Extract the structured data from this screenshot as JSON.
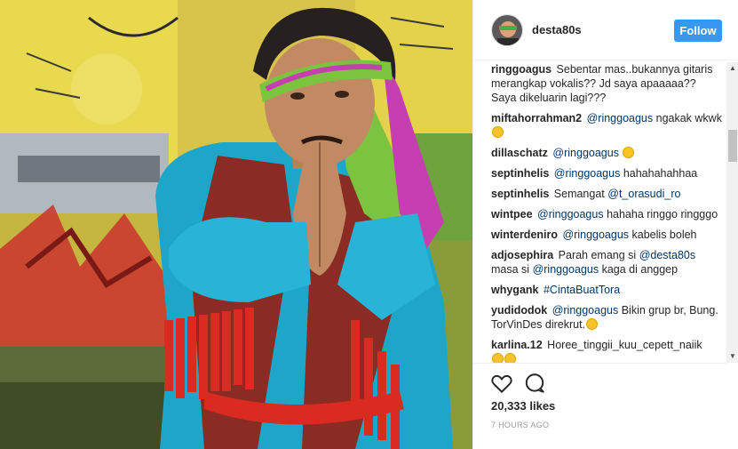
{
  "post": {
    "username": "desta80s",
    "follow_label": "Follow",
    "likes": "20,333 likes",
    "time": "7 HOURS AGO"
  },
  "comments": [
    {
      "user": "ringgoagus",
      "mention": "",
      "text": "Sebentar mas..bukannya gitaris merangkap vokalis?? Jd saya apaaaaa?? Saya dikeluarin lagi???",
      "emoji": ""
    },
    {
      "user": "miftahorrahman2",
      "mention": "@ringgoagus",
      "text": "ngakak wkwk",
      "emoji": "grinning-emoji"
    },
    {
      "user": "dillaschatz",
      "mention": "@ringgoagus",
      "text": "",
      "emoji": "laughing-emoji"
    },
    {
      "user": "septinhelis",
      "mention": "@ringgoagus",
      "text": "hahahahahhaa",
      "emoji": ""
    },
    {
      "user": "septinhelis",
      "mention": "",
      "text": "Semangat",
      "mention2": "@t_orasudi_ro",
      "emoji": ""
    },
    {
      "user": "wintpee",
      "mention": "@ringgoagus",
      "text": "hahaha ringgo ringggo",
      "emoji": ""
    },
    {
      "user": "winterdeniro",
      "mention": "@ringgoagus",
      "text": "kabelis boleh",
      "emoji": ""
    },
    {
      "user": "adjosephira",
      "mention": "",
      "text": "Parah emang si",
      "mention2": "@desta80s",
      "text2": "masa si",
      "mention3": "@ringgoagus",
      "text3": "kaga di anggep",
      "emoji": ""
    },
    {
      "user": "whygank",
      "mention": "",
      "text": "#CintaBuatTora",
      "emoji": ""
    },
    {
      "user": "yudidodok",
      "mention": "@ringgoagus",
      "text": "Bikin grup br, Bung. TorVinDes direkrut.",
      "emoji": "smile-emoji"
    },
    {
      "user": "karlina.12",
      "mention": "",
      "text": "Horee_tinggii_kuu_cepett_naiik",
      "emoji": "sunglasses-emoji"
    }
  ],
  "icons": {
    "like": "heart-outline-icon",
    "comment": "speech-bubble-icon",
    "scroll_up": "triangle-up-icon",
    "scroll_down": "triangle-down-icon"
  },
  "colors": {
    "follow_button": "#3897f0",
    "text": "#262626",
    "time": "#999999"
  }
}
